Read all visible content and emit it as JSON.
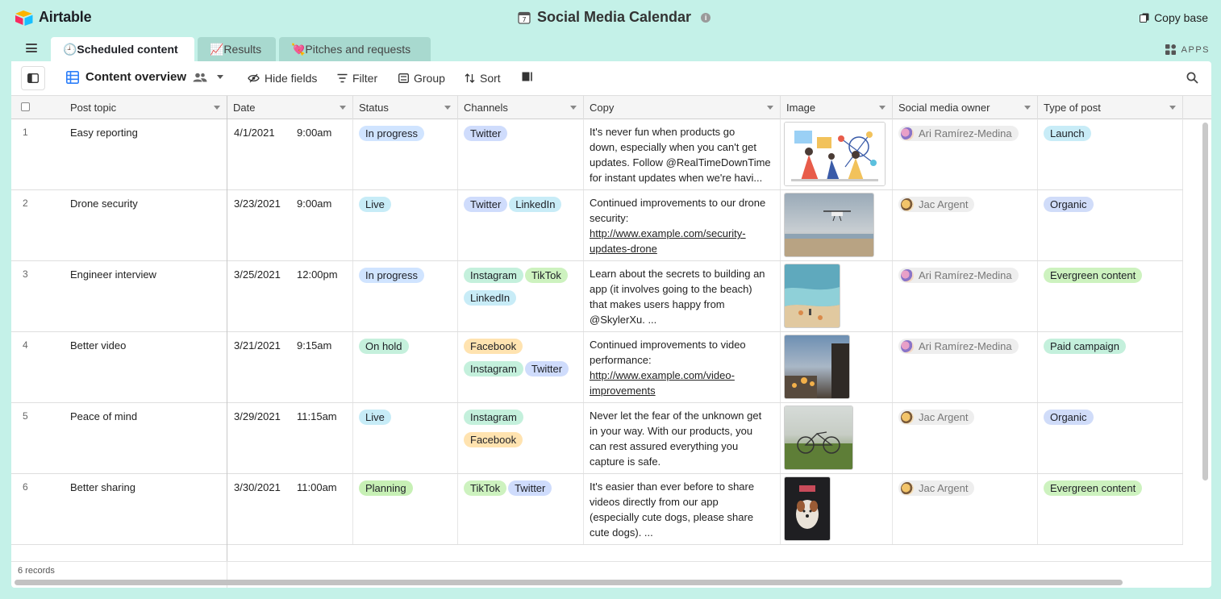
{
  "app": {
    "name": "Airtable"
  },
  "base": {
    "title": "Social Media Calendar",
    "info": "i",
    "copy_label": "Copy base"
  },
  "tabs": [
    {
      "label": "🕘Scheduled content",
      "active": true
    },
    {
      "label": "📈Results",
      "active": false
    },
    {
      "label": "💘Pitches and requests",
      "active": false
    }
  ],
  "apps_label": "APPS",
  "toolbar": {
    "view_name": "Content overview",
    "hide_fields": "Hide fields",
    "filter": "Filter",
    "group": "Group",
    "sort": "Sort"
  },
  "columns": [
    "Post topic",
    "Date",
    "Status",
    "Channels",
    "Copy",
    "Image",
    "Social media owner",
    "Type of post"
  ],
  "colors": {
    "status": {
      "In progress": "#d0e4ff",
      "Live": "#c7ecf7",
      "On hold": "#c5f0dc",
      "Planning": "#c7f0b5"
    },
    "channel": {
      "Twitter": "#cfdcfc",
      "LinkedIn": "#c8ecf7",
      "Instagram": "#c4f0dc",
      "TikTok": "#cdf2bf",
      "Facebook": "#ffe3b0"
    },
    "type": {
      "Launch": "#c8ecf7",
      "Organic": "#d0dcf9",
      "Evergreen content": "#cdf2bf",
      "Paid campaign": "#c4f0dc"
    }
  },
  "rows": [
    {
      "num": "1",
      "topic": "Easy reporting",
      "date": "4/1/2021",
      "time": "9:00am",
      "status": "In progress",
      "channels": [
        "Twitter"
      ],
      "copy_lines": [
        "It's never fun when products go",
        "down, especially when you can't get",
        "updates. Follow @RealTimeDownTime",
        "for instant updates when we're havi..."
      ],
      "copy_links": [],
      "image": "illustration",
      "owner": "Ari Ramírez-Medina",
      "type": "Launch"
    },
    {
      "num": "2",
      "topic": "Drone security",
      "date": "3/23/2021",
      "time": "9:00am",
      "status": "Live",
      "channels": [
        "Twitter",
        "LinkedIn"
      ],
      "copy_lines": [
        "Continued improvements to our drone",
        "security:",
        "http://www.example.com/security-",
        "updates-drone"
      ],
      "copy_links": [
        2,
        3
      ],
      "image": "drone",
      "owner": "Jac Argent",
      "type": "Organic"
    },
    {
      "num": "3",
      "topic": "Engineer interview",
      "date": "3/25/2021",
      "time": "12:00pm",
      "status": "In progress",
      "channels": [
        "Instagram",
        "TikTok",
        "LinkedIn"
      ],
      "copy_lines": [
        "Learn about the secrets to building an",
        "app (it involves going to the beach)",
        "that makes users happy from",
        "@SkylerXu. ..."
      ],
      "copy_links": [],
      "image": "beach",
      "owner": "Ari Ramírez-Medina",
      "type": "Evergreen content"
    },
    {
      "num": "4",
      "topic": "Better video",
      "date": "3/21/2021",
      "time": "9:15am",
      "status": "On hold",
      "channels": [
        "Facebook",
        "Instagram",
        "Twitter"
      ],
      "copy_lines": [
        "Continued improvements to video",
        "performance:",
        "http://www.example.com/video-",
        "improvements"
      ],
      "copy_links": [
        2,
        3
      ],
      "image": "street",
      "owner": "Ari Ramírez-Medina",
      "type": "Paid campaign"
    },
    {
      "num": "5",
      "topic": "Peace of mind",
      "date": "3/29/2021",
      "time": "11:15am",
      "status": "Live",
      "channels": [
        "Instagram",
        "Facebook"
      ],
      "copy_lines": [
        "Never let the fear of the unknown get",
        "in your way. With our products, you",
        "can rest assured everything you",
        "capture is safe."
      ],
      "copy_links": [],
      "image": "bike",
      "owner": "Jac Argent",
      "type": "Organic"
    },
    {
      "num": "6",
      "topic": "Better sharing",
      "date": "3/30/2021",
      "time": "11:00am",
      "status": "Planning",
      "channels": [
        "TikTok",
        "Twitter"
      ],
      "copy_lines": [
        "It's easier than ever before to share",
        "videos directly from our app",
        "(especially cute dogs, please share",
        "cute dogs). ..."
      ],
      "copy_links": [],
      "image": "dog",
      "owner": "Jac Argent",
      "type": "Evergreen content"
    }
  ],
  "footer": {
    "records": "6 records"
  }
}
